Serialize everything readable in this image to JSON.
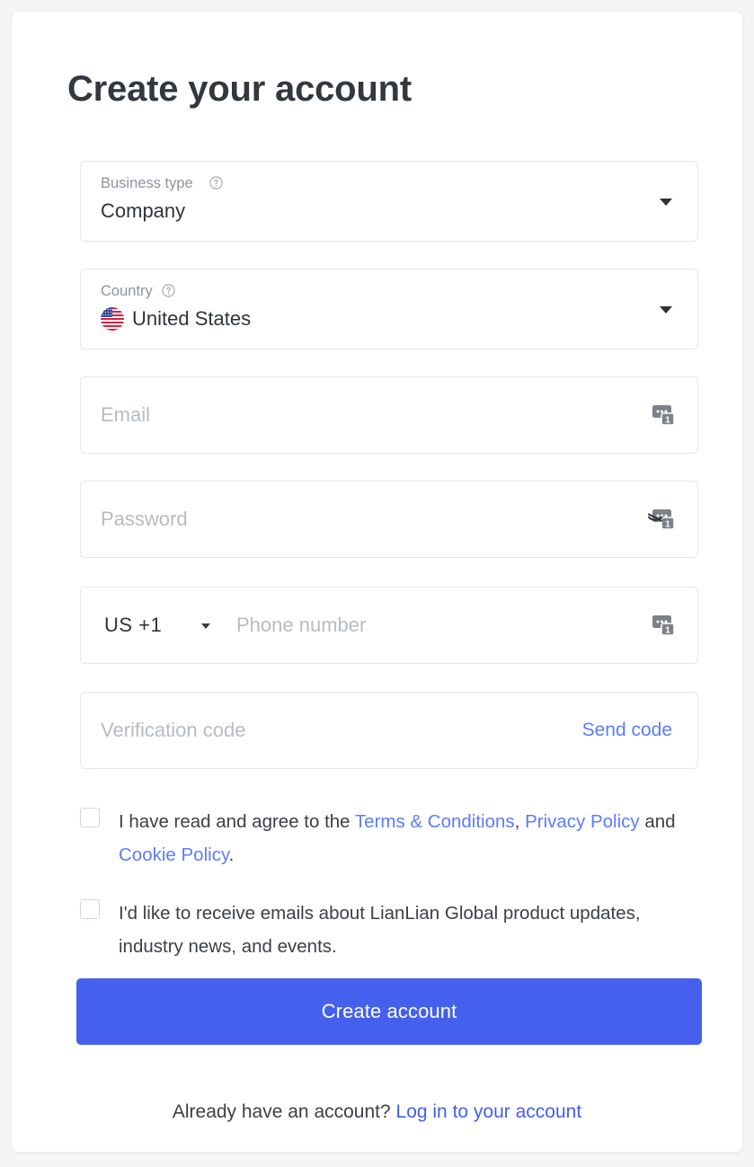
{
  "page": {
    "title": "Create your account",
    "background_color": "#f4f5f7",
    "card_background": "#ffffff",
    "accent_color": "#4460ec",
    "link_color": "#5b7cfa",
    "border_color": "#e4e6ee"
  },
  "fields": {
    "business_type": {
      "label": "Business type",
      "value": "Company",
      "help_icon": "question-circle-icon",
      "caret_icon": "chevron-down-icon"
    },
    "country": {
      "label": "Country",
      "value": "United States",
      "flag_icon": "us-flag-icon",
      "help_icon": "question-circle-icon",
      "caret_icon": "chevron-down-icon"
    },
    "email": {
      "placeholder": "Email",
      "autofill_icon": "autofill-badge-icon",
      "autofill_badge": "1"
    },
    "password": {
      "placeholder": "Password",
      "autofill_icon": "autofill-badge-hidden-icon",
      "autofill_badge": "1",
      "visibility_icon": "eye-slash-icon"
    },
    "phone": {
      "country_code": "US  +1",
      "placeholder": "Phone number",
      "caret_icon": "chevron-down-icon",
      "autofill_icon": "autofill-badge-icon",
      "autofill_badge": "1"
    },
    "verification": {
      "placeholder": "Verification code",
      "send_code_label": "Send code"
    }
  },
  "consents": {
    "terms": {
      "prefix": "I have read and agree to the ",
      "link_terms": "Terms & Conditions",
      "comma": ", ",
      "link_privacy": "Privacy Policy",
      "conjunction": " and ",
      "link_cookie": "Cookie Policy",
      "suffix": ".",
      "checked": false
    },
    "marketing": {
      "text": "I'd like to receive emails about LianLian Global product updates, industry news, and events.",
      "checked": false
    }
  },
  "actions": {
    "submit_label": "Create account"
  },
  "footer": {
    "text": "Already have an account? ",
    "login_link": "Log in to your account"
  }
}
